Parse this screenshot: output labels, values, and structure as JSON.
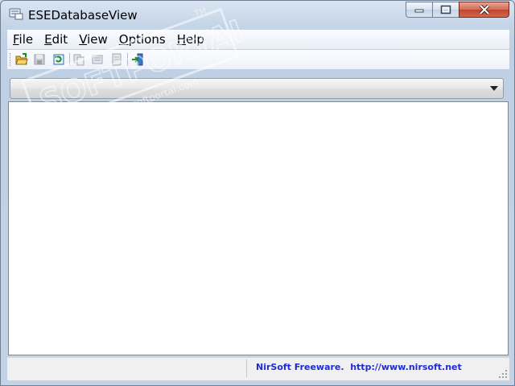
{
  "window": {
    "title": "ESEDatabaseView",
    "icon": "database-app-icon",
    "controls": {
      "minimize": "minimize-icon",
      "maximize": "maximize-icon",
      "close": "close-icon"
    }
  },
  "menu": {
    "items": [
      {
        "id": "file",
        "label": "File"
      },
      {
        "id": "edit",
        "label": "Edit"
      },
      {
        "id": "view",
        "label": "View"
      },
      {
        "id": "options",
        "label": "Options"
      },
      {
        "id": "help",
        "label": "Help"
      }
    ]
  },
  "toolbar": {
    "buttons": [
      {
        "id": "open",
        "icon": "open-folder-icon",
        "enabled": true
      },
      {
        "id": "save",
        "icon": "save-icon",
        "enabled": false
      },
      {
        "id": "refresh",
        "icon": "refresh-icon",
        "enabled": true
      },
      {
        "id": "copy",
        "icon": "copy-icon",
        "enabled": false
      },
      {
        "id": "properties",
        "icon": "properties-icon",
        "enabled": false
      },
      {
        "id": "html-report",
        "icon": "report-icon",
        "enabled": false
      },
      {
        "id": "exit",
        "icon": "exit-icon",
        "enabled": true
      }
    ]
  },
  "table_selector": {
    "value": ""
  },
  "status_bar": {
    "left_text": "",
    "credit": "NirSoft Freeware.  http://www.nirsoft.net"
  },
  "watermark": {
    "brand": "SOFTPORTAL",
    "trademark": "TM",
    "url": "www.softportal.com"
  },
  "colors": {
    "credit_link": "#1f2bd4",
    "close_button": "#c8503a",
    "frame": "#c2d3e6"
  }
}
